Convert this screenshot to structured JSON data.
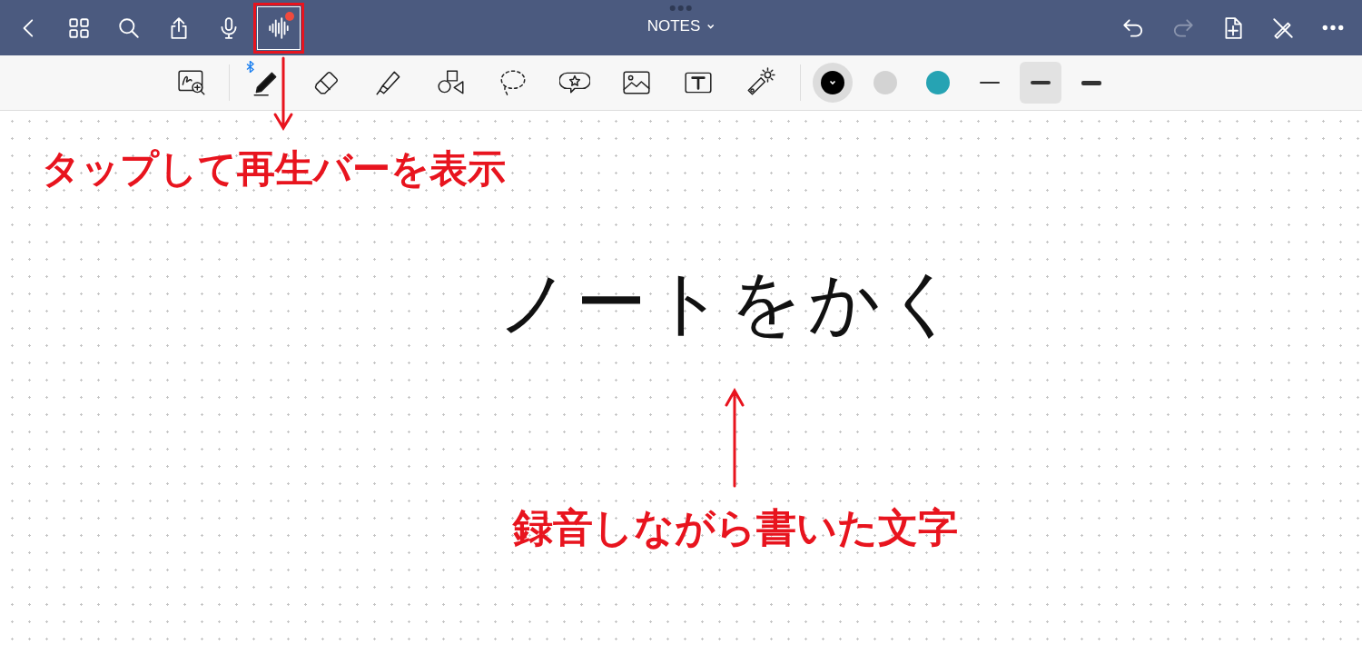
{
  "top_bar": {
    "title": "NOTES",
    "left_buttons": [
      {
        "kind": "back"
      },
      {
        "kind": "grid"
      },
      {
        "kind": "search"
      },
      {
        "kind": "share"
      },
      {
        "kind": "mic"
      },
      {
        "kind": "audio",
        "recording": true,
        "highlighted": true
      }
    ],
    "right_buttons": [
      {
        "kind": "undo",
        "disabled": false
      },
      {
        "kind": "redo",
        "disabled": true
      },
      {
        "kind": "add-page",
        "disabled": false
      },
      {
        "kind": "pen-off",
        "disabled": false
      },
      {
        "kind": "more",
        "disabled": false
      }
    ]
  },
  "toolbar": {
    "tools": [
      {
        "kind": "zoom"
      },
      {
        "kind": "pen",
        "bluetooth": true
      },
      {
        "kind": "eraser"
      },
      {
        "kind": "highlighter"
      },
      {
        "kind": "shapes"
      },
      {
        "kind": "lasso"
      },
      {
        "kind": "sticker"
      },
      {
        "kind": "image"
      },
      {
        "kind": "text"
      },
      {
        "kind": "laser"
      }
    ],
    "colors": [
      {
        "color": "#000000",
        "selected": true
      },
      {
        "color": "#d3d3d3",
        "selected": false
      },
      {
        "color": "#26a3b3",
        "selected": false
      }
    ],
    "widths": [
      {
        "kind": "thin",
        "selected": false
      },
      {
        "kind": "medium",
        "selected": true
      },
      {
        "kind": "thick",
        "selected": false
      }
    ]
  },
  "page": {
    "handwriting": "ノートをかく"
  },
  "annotations": [
    {
      "kind": "button-callout",
      "text": "タップして再生バーを表示"
    },
    {
      "kind": "ink-callout",
      "text": "録音しながら書いた文字"
    }
  ]
}
